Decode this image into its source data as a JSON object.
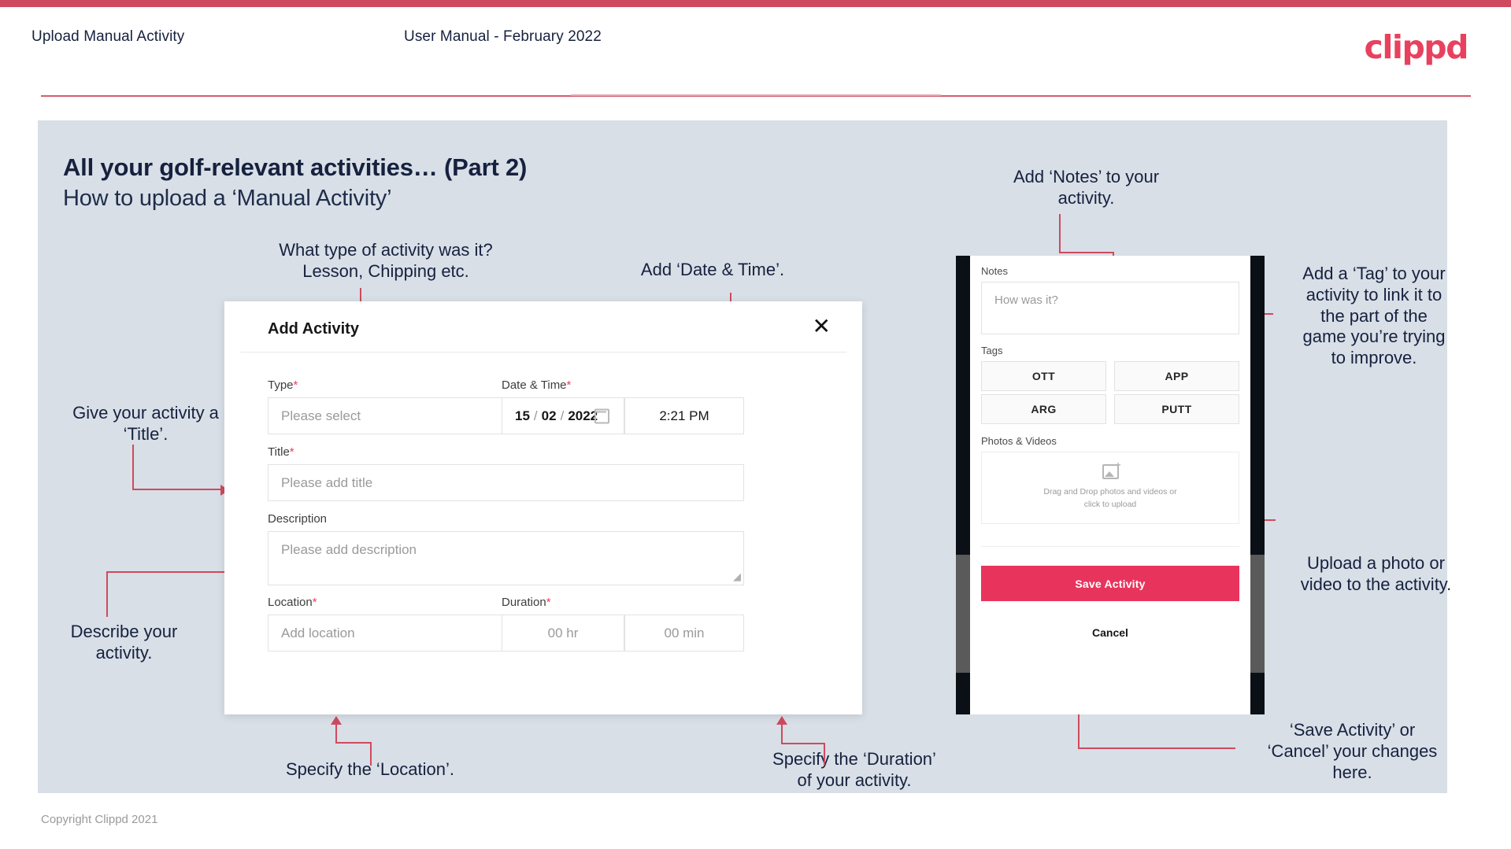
{
  "header": {
    "title": "Upload Manual Activity",
    "subtitle": "User Manual - February 2022",
    "logo": "clippd"
  },
  "slide": {
    "heading": "All your golf-relevant activities… (Part 2)",
    "subheading": "How to upload a ‘Manual Activity’"
  },
  "annotations": {
    "type": "What type of activity was it?\nLesson, Chipping etc.",
    "datetime": "Add ‘Date & Time’.",
    "title": "Give your activity a\n‘Title’.",
    "description": "Describe your\nactivity.",
    "location": "Specify the ‘Location’.",
    "duration": "Specify the ‘Duration’\nof your activity.",
    "notes": "Add ‘Notes’ to your\nactivity.",
    "tags": "Add a ‘Tag’ to your\nactivity to link it to\nthe part of the\ngame you’re trying\nto improve.",
    "upload": "Upload a photo or\nvideo to the activity.",
    "save": "‘Save Activity’ or\n‘Cancel’ your changes\nhere."
  },
  "dialog": {
    "title": "Add Activity",
    "close_icon": "close-icon",
    "fields": {
      "type": {
        "label": "Type",
        "required": "*",
        "placeholder": "Please select"
      },
      "datetime": {
        "label": "Date & Time",
        "required": "*",
        "day": "15",
        "month": "02",
        "year": "2022",
        "sep": "/",
        "time": "2:21 PM"
      },
      "title": {
        "label": "Title",
        "required": "*",
        "placeholder": "Please add title"
      },
      "description": {
        "label": "Description",
        "required": "",
        "placeholder": "Please add description"
      },
      "location": {
        "label": "Location",
        "required": "*",
        "placeholder": "Add location"
      },
      "duration": {
        "label": "Duration",
        "required": "*",
        "hours": "00 hr",
        "minutes": "00 min"
      }
    }
  },
  "phone": {
    "notes": {
      "label": "Notes",
      "placeholder": "How was it?"
    },
    "tags": {
      "label": "Tags",
      "items": [
        "OTT",
        "APP",
        "ARG",
        "PUTT"
      ]
    },
    "photos": {
      "label": "Photos & Videos",
      "drop_line1": "Drag and Drop photos and videos or",
      "drop_line2": "click to upload"
    },
    "save_label": "Save Activity",
    "cancel_label": "Cancel"
  },
  "footer": {
    "copyright": "Copyright Clippd 2021"
  },
  "colors": {
    "accent": "#e8415e",
    "brand_pink": "#cf4a5e",
    "stage": "#d8dfe7",
    "ink": "#16213e",
    "save": "#e8345c"
  }
}
